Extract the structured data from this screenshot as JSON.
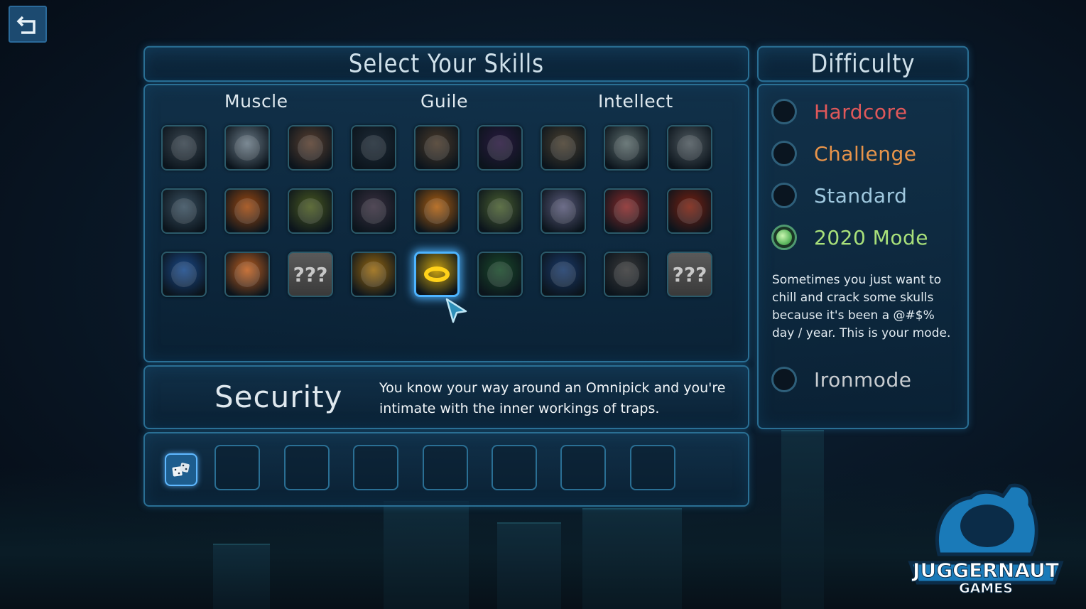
{
  "back_button": {
    "icon": "back-arrow-icon"
  },
  "skills_panel": {
    "title": "Select Your Skills",
    "categories": [
      "Muscle",
      "Guile",
      "Intellect"
    ],
    "locked_label": "???",
    "rows": [
      [
        "portrait-mech-icon",
        "portrait-white-armor-icon",
        "portrait-bronze-armor-icon",
        "portrait-dark-robot-icon",
        "portrait-hooded-icon",
        "portrait-shadow-icon",
        "portrait-gasmask-icon",
        "portrait-android-icon",
        "portrait-alien-icon"
      ],
      [
        "mace-icon",
        "rage-icon",
        "gun-blast-icon",
        "dash-icon",
        "crossed-swords-icon",
        "explosive-shot-icon",
        "grenade-icon",
        "third-eye-icon",
        "potion-icon"
      ],
      [
        "flex-arm-icon",
        "fist-icon",
        "locked-icon",
        "totem-icon",
        "omnipick-ring-icon",
        "shadow-runner-icon",
        "hologram-icon",
        "orbs-icon",
        "locked-icon"
      ]
    ],
    "selected_skill": "omnipick-ring-icon"
  },
  "skill_info": {
    "name": "Security",
    "description_line1": "You know your way around an Omnipick and you're",
    "description_line2": "intimate with the inner workings of traps."
  },
  "loadout": {
    "slot_count": 8,
    "first_slot_icon": "dice-icon"
  },
  "difficulty": {
    "title": "Difficulty",
    "options": [
      {
        "label": "Hardcore",
        "color": "#e0585a",
        "selected": false
      },
      {
        "label": "Challenge",
        "color": "#e8944a",
        "selected": false
      },
      {
        "label": "Standard",
        "color": "#9fc8de",
        "selected": false
      },
      {
        "label": "2020 Mode",
        "color": "#a8e07a",
        "selected": true
      }
    ],
    "description": "Sometimes you just want to chill and crack some skulls because it's been a @#$% day / year. This is your mode.",
    "extra_option": {
      "label": "Ironmode",
      "color": "#c8ccd0",
      "selected": false
    }
  },
  "logo": {
    "line1": "JUGGERNAUT",
    "line2": "GAMES"
  }
}
